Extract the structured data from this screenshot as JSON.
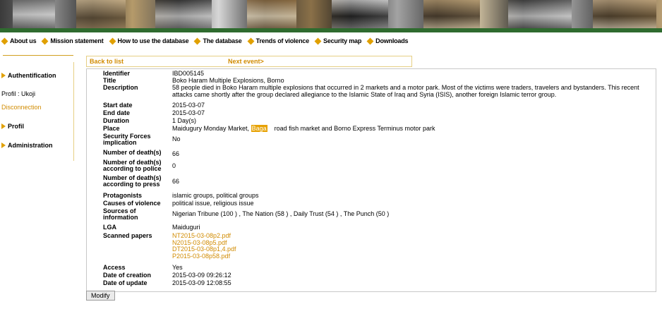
{
  "nav": [
    {
      "label": "About us",
      "name": "nav-about-us"
    },
    {
      "label": "Mission statement",
      "name": "nav-mission-statement"
    },
    {
      "label": "How to use the database",
      "name": "nav-how-to-use"
    },
    {
      "label": "The database",
      "name": "nav-the-database"
    },
    {
      "label": "Trends of violence",
      "name": "nav-trends-of-violence"
    },
    {
      "label": "Security map",
      "name": "nav-security-map"
    },
    {
      "label": "Downloads",
      "name": "nav-downloads"
    }
  ],
  "sidebar": {
    "authentification": "Authentification",
    "profil_user": "Profil : Ukoji",
    "disconnection": "Disconnection",
    "profil": "Profil",
    "administration": "Administration"
  },
  "toplinks": {
    "back": "Back to list",
    "next": "Next event>"
  },
  "details": {
    "identifier": {
      "label": "Identifier",
      "value": "IBD005145"
    },
    "title": {
      "label": "Title",
      "value": "Boko Haram Multiple Explosions, Borno"
    },
    "description": {
      "label": "Description",
      "value": "58 people died in Boko Haram multiple explosions that occurred in 2 markets and a motor park. Most of the victims were traders, travelers and bystanders. This recent attacks came shortly after the group declared allegiance to the Islamic State of Iraq and Syria (ISIS), another foreign Islamic terror group."
    },
    "start_date": {
      "label": "Start date",
      "value": "2015-03-07"
    },
    "end_date": {
      "label": "End date",
      "value": "2015-03-07"
    },
    "duration": {
      "label": "Duration",
      "value": "1 Day(s)"
    },
    "place": {
      "label": "Place",
      "prefix": "Maidugury Monday Market,",
      "highlight": "Baga",
      "suffix": "road fish market and Borno Express Terminus motor park"
    },
    "security_forces": {
      "label": "Security Forces implication",
      "value": "No"
    },
    "deaths": {
      "label": "Number of death(s)",
      "value": "66"
    },
    "deaths_police": {
      "label": "Number of death(s) according to police",
      "value": "0"
    },
    "deaths_press": {
      "label": "Number of death(s) according to press",
      "value": "66"
    },
    "protagonists": {
      "label": "Protagonists",
      "value": "islamic groups, political groups"
    },
    "causes": {
      "label": "Causes of violence",
      "value": "political issue, religious issue"
    },
    "sources": {
      "label": "Sources of information",
      "value": "Nigerian Tribune (100 ) , The Nation (58 ) , Daily Trust (54 ) , The Punch (50 )"
    },
    "lga": {
      "label": "LGA",
      "value": "Maiduguri"
    },
    "scanned": {
      "label": "Scanned papers",
      "files": [
        "NT2015-03-08p2.pdf",
        "N2015-03-08p5.pdf",
        "DT2015-03-08p1,4.pdf",
        "P2015-03-08p58.pdf"
      ]
    },
    "access": {
      "label": "Access",
      "value": "Yes"
    },
    "date_creation": {
      "label": "Date of creation",
      "value": "2015-03-09 09:26:12"
    },
    "date_update": {
      "label": "Date of update",
      "value": "2015-03-09 12:08:55"
    }
  },
  "modify_label": "Modify"
}
